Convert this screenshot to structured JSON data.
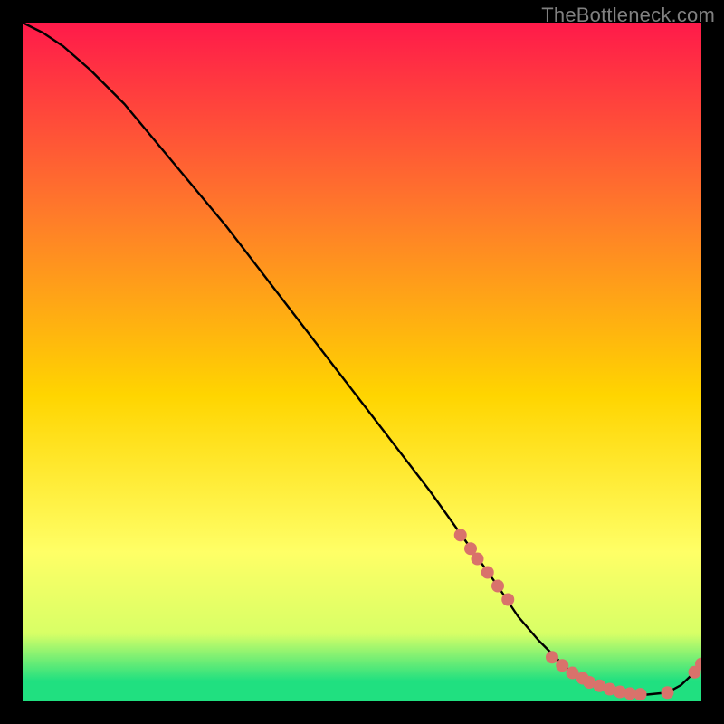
{
  "watermark": "TheBottleneck.com",
  "chart_data": {
    "type": "line",
    "title": "",
    "xlabel": "",
    "ylabel": "",
    "xlim": [
      0,
      100
    ],
    "ylim": [
      0,
      100
    ],
    "gradient_colors": {
      "top": "#ff1a4a",
      "upper_mid": "#ff7a2a",
      "mid": "#ffd500",
      "lower_mid": "#ffff66",
      "near_bottom": "#d8ff66",
      "bottom": "#20e080"
    },
    "curve": {
      "x": [
        0,
        3,
        6,
        10,
        15,
        20,
        30,
        40,
        50,
        60,
        65,
        70,
        73,
        76,
        80,
        84,
        88,
        92,
        95,
        97,
        99,
        100
      ],
      "y": [
        100,
        98.5,
        96.5,
        93,
        88,
        82,
        70,
        57,
        44,
        31,
        24,
        17,
        12.5,
        9,
        5,
        2.5,
        1.3,
        1,
        1.3,
        2.4,
        4.3,
        5.5
      ]
    },
    "markers": {
      "color": "#d9726b",
      "radius_px": 7,
      "points": [
        {
          "x": 64.5,
          "y": 24.5
        },
        {
          "x": 66,
          "y": 22.5
        },
        {
          "x": 67,
          "y": 21
        },
        {
          "x": 68.5,
          "y": 19
        },
        {
          "x": 70,
          "y": 17
        },
        {
          "x": 71.5,
          "y": 15
        },
        {
          "x": 78,
          "y": 6.5
        },
        {
          "x": 79.5,
          "y": 5.3
        },
        {
          "x": 81,
          "y": 4.2
        },
        {
          "x": 82.5,
          "y": 3.4
        },
        {
          "x": 83.5,
          "y": 2.8
        },
        {
          "x": 85,
          "y": 2.3
        },
        {
          "x": 86.5,
          "y": 1.8
        },
        {
          "x": 88,
          "y": 1.4
        },
        {
          "x": 89.5,
          "y": 1.15
        },
        {
          "x": 91,
          "y": 1.05
        },
        {
          "x": 95,
          "y": 1.3
        },
        {
          "x": 99,
          "y": 4.3
        },
        {
          "x": 100,
          "y": 5.5
        }
      ]
    }
  }
}
